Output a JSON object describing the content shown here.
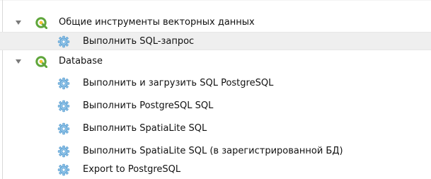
{
  "tree": {
    "groups": [
      {
        "label": "Общие инструменты векторных данных",
        "items": [
          {
            "label": "Выполнить SQL-запрос"
          }
        ]
      },
      {
        "label": "Database",
        "items": [
          {
            "label": "Выполнить и загрузить SQL PostgreSQL"
          },
          {
            "label": "Выполнить PostgreSQL SQL"
          },
          {
            "label": "Выполнить SpatiaLite SQL"
          },
          {
            "label": "Выполнить SpatiaLite SQL (в зарегистрированной БД)"
          },
          {
            "label": "Export to PostgreSQL"
          }
        ]
      }
    ]
  },
  "colors": {
    "selection": "#efefef",
    "qgis_green": "#5fa63b",
    "qgis_yellow": "#f2c230",
    "gear_blue": "#8fc3e8",
    "gear_blue_dark": "#5c9fd1",
    "text": "#111111"
  },
  "icons": {
    "expander": "chevron-down-icon",
    "group": "qgis-logo-icon",
    "item": "gear-icon"
  }
}
